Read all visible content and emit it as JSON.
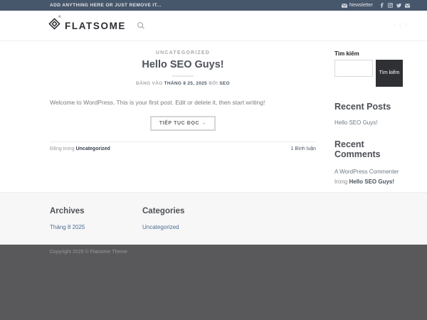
{
  "topbar": {
    "left_text": "ADD ANYTHING HERE OR JUST REMOVE IT...",
    "newsletter_label": "Newsletter"
  },
  "header": {
    "logo_text": "FLATSOME",
    "logo_reg": "®"
  },
  "post": {
    "category": "UNCATEGORIZED",
    "title": "Hello SEO Guys!",
    "meta_posted": "ĐĂNG VÀO",
    "meta_date": "THÁNG 8 25, 2025",
    "meta_by": "BỞI",
    "meta_author": "SEO",
    "excerpt": "Welcome to WordPress. This is your first post. Edit or delete it, then start writing!",
    "read_more_label": "TIẾP TỤC ĐỌC →",
    "posted_in_label": "Đăng trong",
    "category_link": "Uncategorized",
    "comments_link": "1 Bình luận"
  },
  "sidebar": {
    "search_label": "Tìm kiếm",
    "search_button_label": "Tìm kiếm",
    "recent_posts_title": "Recent Posts",
    "recent_posts": [
      "Hello SEO Guys!"
    ],
    "recent_comments_title": "Recent Comments",
    "comment_author": "A WordPress Commenter",
    "comment_on_word": "trong",
    "comment_post": "Hello SEO Guys!"
  },
  "footer": {
    "archives_title": "Archives",
    "archives": [
      "Tháng 8 2025"
    ],
    "categories_title": "Categories",
    "categories": [
      "Uncategorized"
    ],
    "copyright": "Copyright 2025 © Flatsome Theme"
  },
  "colors": {
    "topbar_bg": "#46566b",
    "search_button_bg": "#2f3033",
    "footer_widgets_bg": "#f7f7f7",
    "absolute_footer_bg": "#59595b",
    "footer_link": "#4a6d92"
  }
}
